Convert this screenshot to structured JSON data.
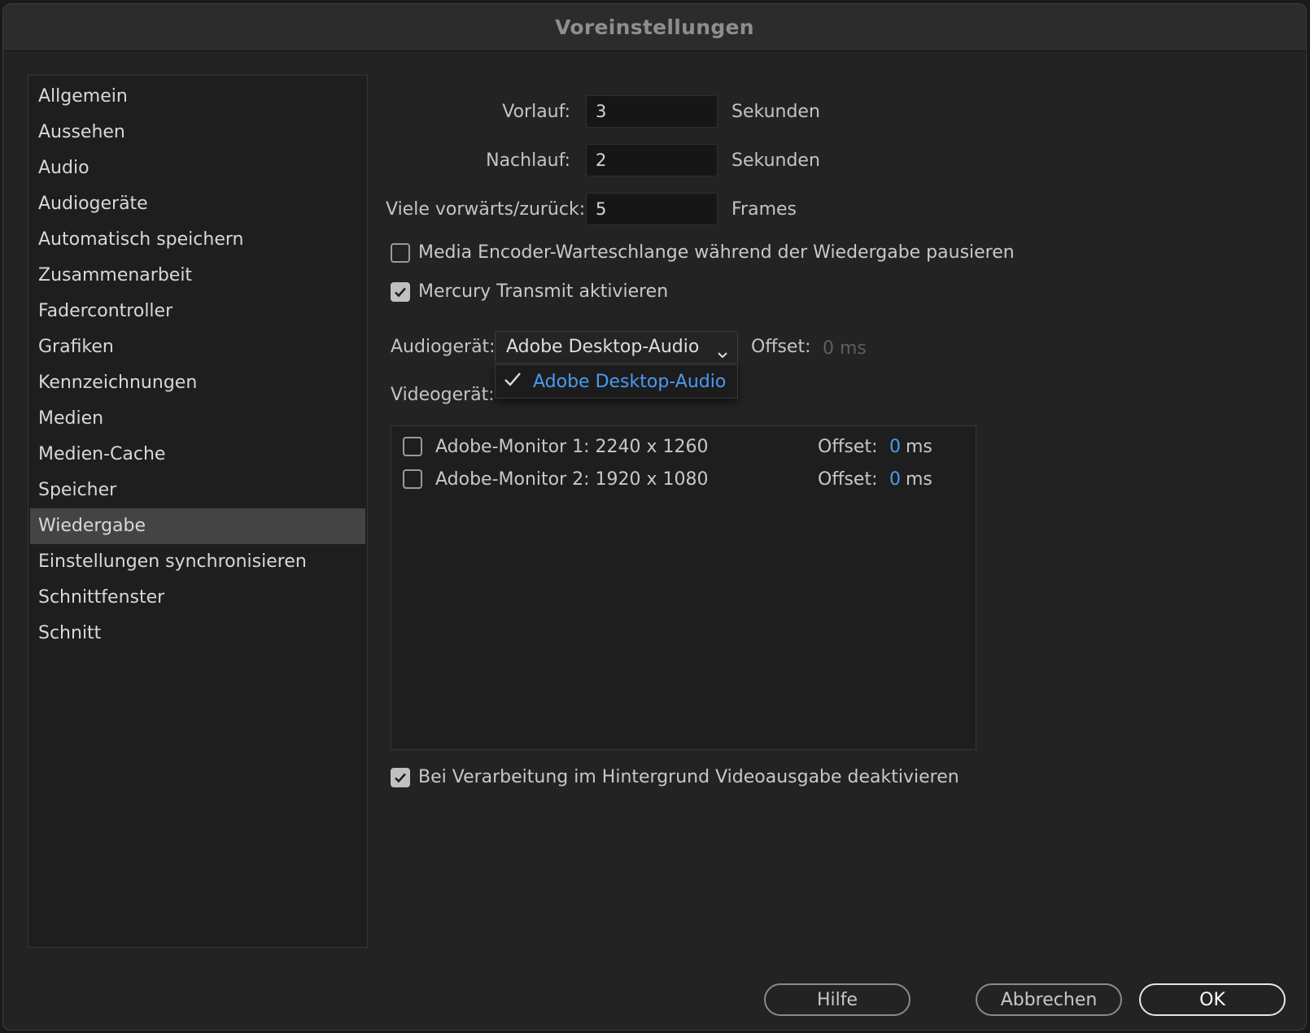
{
  "window": {
    "title": "Voreinstellungen"
  },
  "sidebar": {
    "items": [
      {
        "label": "Allgemein"
      },
      {
        "label": "Aussehen"
      },
      {
        "label": "Audio"
      },
      {
        "label": "Audiogeräte"
      },
      {
        "label": "Automatisch speichern"
      },
      {
        "label": "Zusammenarbeit"
      },
      {
        "label": "Fadercontroller"
      },
      {
        "label": "Grafiken"
      },
      {
        "label": "Kennzeichnungen"
      },
      {
        "label": "Medien"
      },
      {
        "label": "Medien-Cache"
      },
      {
        "label": "Speicher"
      },
      {
        "label": "Wiedergabe",
        "selected": true
      },
      {
        "label": "Einstellungen synchronisieren"
      },
      {
        "label": "Schnittfenster"
      },
      {
        "label": "Schnitt"
      }
    ]
  },
  "playback": {
    "preroll": {
      "label": "Vorlauf:",
      "value": "3",
      "unit": "Sekunden"
    },
    "postroll": {
      "label": "Nachlauf:",
      "value": "2",
      "unit": "Sekunden"
    },
    "step": {
      "label": "Viele vorwärts/zurück:",
      "value": "5",
      "unit": "Frames"
    },
    "pause_encoder": {
      "label": "Media Encoder-Warteschlange während der Wiedergabe pausieren",
      "checked": false
    },
    "mercury": {
      "label": "Mercury Transmit aktivieren",
      "checked": true
    },
    "audio_device": {
      "label": "Audiogerät:",
      "selected": "Adobe Desktop-Audio",
      "offset_label": "Offset:",
      "offset_value": "0 ms",
      "options": [
        "Adobe Desktop-Audio"
      ]
    },
    "video_device": {
      "label": "Videogerät:",
      "monitors": [
        {
          "name": "Adobe-Monitor 1: 2240 x 1260",
          "checked": false,
          "offset_label": "Offset:",
          "offset_value": "0",
          "unit": "ms"
        },
        {
          "name": "Adobe-Monitor 2: 1920 x 1080",
          "checked": false,
          "offset_label": "Offset:",
          "offset_value": "0",
          "unit": "ms"
        }
      ]
    },
    "disable_bg": {
      "label": "Bei Verarbeitung im Hintergrund Videoausgabe deaktivieren",
      "checked": true
    }
  },
  "buttons": {
    "help": "Hilfe",
    "cancel": "Abbrechen",
    "ok": "OK"
  },
  "colors": {
    "accent": "#4a9af3",
    "panel": "#232323",
    "selected_item": "#444444"
  }
}
